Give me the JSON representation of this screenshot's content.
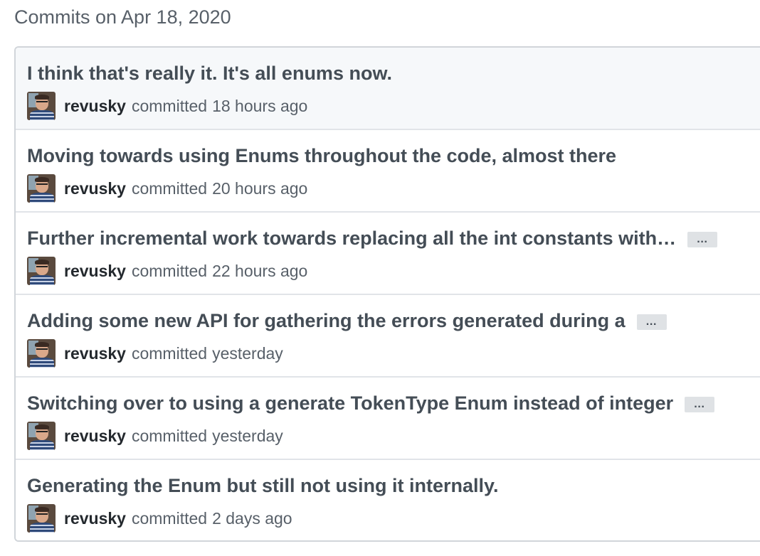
{
  "heading": "Commits on Apr 18, 2020",
  "commits": [
    {
      "title": "I think that's really it. It's all enums now.",
      "has_more": false,
      "author": "revusky",
      "action": "committed",
      "time": "18 hours ago"
    },
    {
      "title": "Moving towards using Enums throughout the code, almost there",
      "has_more": false,
      "author": "revusky",
      "action": "committed",
      "time": "20 hours ago"
    },
    {
      "title": "Further incremental work towards replacing all the int constants with…",
      "has_more": true,
      "ellipsis": "…",
      "author": "revusky",
      "action": "committed",
      "time": "22 hours ago"
    },
    {
      "title": "Adding some new API for gathering the errors generated during a",
      "has_more": true,
      "ellipsis": "…",
      "author": "revusky",
      "action": "committed",
      "time": "yesterday"
    },
    {
      "title": "Switching over to using a generate TokenType Enum instead of integer",
      "has_more": true,
      "ellipsis": "…",
      "author": "revusky",
      "action": "committed",
      "time": "yesterday"
    },
    {
      "title": "Generating the Enum but still not using it internally.",
      "has_more": false,
      "author": "revusky",
      "action": "committed",
      "time": "2 days ago"
    }
  ],
  "icons": {
    "avatar": "user-avatar-photo",
    "more": "ellipsis-icon"
  },
  "colors": {
    "title": "#444d56",
    "meta": "#586069",
    "border": "#d1d5da",
    "highlight_row": "#f6f8fa",
    "ellipsis_bg": "#dfe2e5"
  }
}
